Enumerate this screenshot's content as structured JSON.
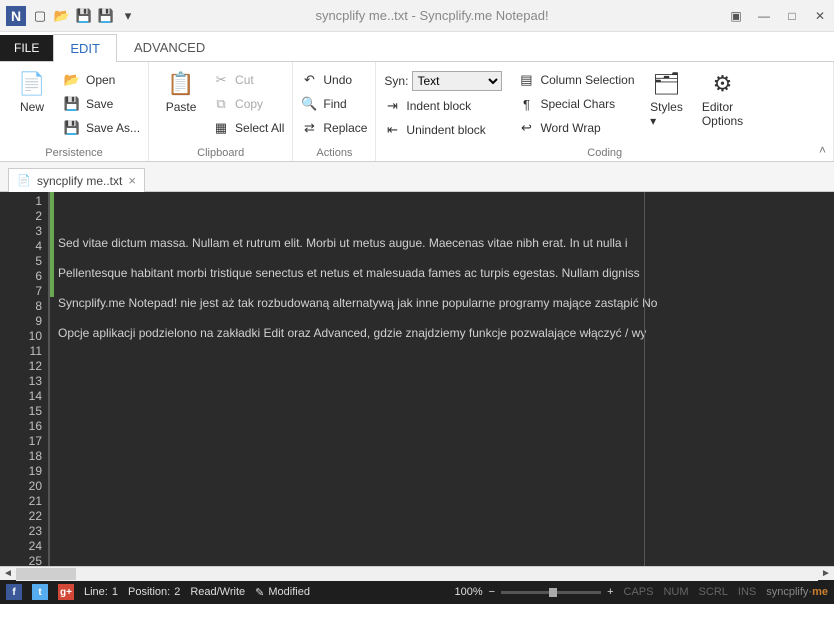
{
  "titlebar": {
    "title": "syncplify me..txt - Syncplify.me Notepad!"
  },
  "tabs": {
    "file": "FILE",
    "edit": "EDIT",
    "advanced": "ADVANCED"
  },
  "ribbon": {
    "persistence": {
      "label": "Persistence",
      "new": "New",
      "open": "Open",
      "save": "Save",
      "saveas": "Save As..."
    },
    "clipboard": {
      "label": "Clipboard",
      "paste": "Paste",
      "cut": "Cut",
      "copy": "Copy",
      "selectall": "Select All"
    },
    "actions": {
      "label": "Actions",
      "undo": "Undo",
      "find": "Find",
      "replace": "Replace"
    },
    "coding": {
      "label": "Coding",
      "syn": "Syn:",
      "syntax_value": "Text",
      "indent": "Indent block",
      "unindent": "Unindent block",
      "colsel": "Column Selection",
      "special": "Special Chars",
      "wrap": "Word Wrap",
      "styles": "Styles",
      "editor_options": "Editor\nOptions"
    }
  },
  "doctab": {
    "name": "syncplify me..txt"
  },
  "editor": {
    "lines": [
      "Sed vitae dictum massa. Nullam et rutrum elit. Morbi ut metus augue. Maecenas vitae nibh erat. In ut nulla i",
      "",
      "Pellentesque habitant morbi tristique senectus et netus et malesuada fames ac turpis egestas. Nullam digniss",
      "",
      "Syncplify.me Notepad! nie jest aż tak rozbudowaną alternatywą jak inne popularne programy mające zastąpić No",
      "",
      "Opcje aplikacji podzielono na zakładki Edit oraz Advanced, gdzie znajdziemy funkcje pozwalające włączyć / wy"
    ],
    "total_rows": 25,
    "modified_rows": [
      1,
      2,
      3,
      4,
      5,
      6,
      7
    ]
  },
  "status": {
    "line_label": "Line:",
    "line": "1",
    "pos_label": "Position:",
    "pos": "2",
    "mode": "Read/Write",
    "modified": "Modified",
    "zoom": "100%",
    "caps": "CAPS",
    "num": "NUM",
    "scrl": "SCRL",
    "ins": "INS",
    "brand_a": "syncplify",
    "brand_b": "me"
  }
}
